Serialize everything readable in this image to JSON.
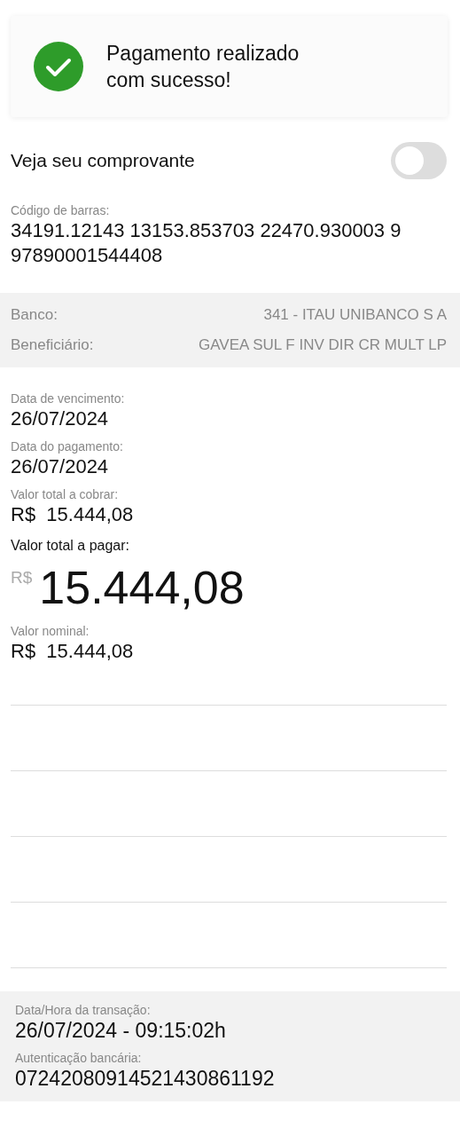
{
  "banner": {
    "kind": "success",
    "message": "Pagamento realizado com sucesso!"
  },
  "receipt_toggle": {
    "label": "Veja seu comprovante",
    "on": false
  },
  "barcode": {
    "label": "Código de barras:",
    "value": "34191.12143 13153.853703 22470.930003 9 97890001544408"
  },
  "parties": [
    {
      "label": "Banco:",
      "value": "341 - ITAU UNIBANCO S A"
    },
    {
      "label": "Beneficiário:",
      "value": "GAVEA SUL F INV DIR CR MULT LP"
    }
  ],
  "fields": [
    {
      "kind": "plain",
      "label": "Data de vencimento:",
      "value": "26/07/2024"
    },
    {
      "kind": "plain",
      "label": "Data do pagamento:",
      "value": "26/07/2024"
    },
    {
      "kind": "money",
      "label": "Valor total a cobrar:",
      "currency": "R$",
      "value": "15.444,08"
    },
    {
      "kind": "total",
      "label": "Valor total a pagar:",
      "currency": "R$",
      "value": "15.444,08"
    },
    {
      "kind": "money",
      "label": "Valor nominal:",
      "currency": "R$",
      "value": "15.444,08"
    }
  ],
  "footer": [
    {
      "label": "Data/Hora da transação:",
      "value": "26/07/2024 - 09:15:02h"
    },
    {
      "label": "Autenticação bancária:",
      "value": "07242080914521430861192"
    }
  ]
}
